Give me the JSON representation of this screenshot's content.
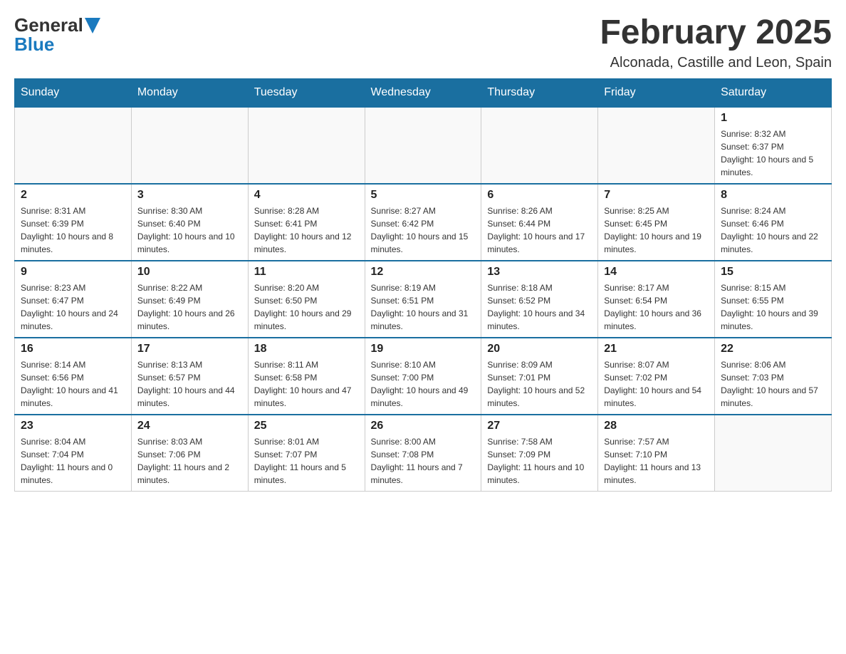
{
  "logo": {
    "text_general": "General",
    "text_blue": "Blue"
  },
  "title": {
    "month_year": "February 2025",
    "location": "Alconada, Castille and Leon, Spain"
  },
  "weekdays": [
    "Sunday",
    "Monday",
    "Tuesday",
    "Wednesday",
    "Thursday",
    "Friday",
    "Saturday"
  ],
  "weeks": [
    [
      {
        "day": "",
        "info": ""
      },
      {
        "day": "",
        "info": ""
      },
      {
        "day": "",
        "info": ""
      },
      {
        "day": "",
        "info": ""
      },
      {
        "day": "",
        "info": ""
      },
      {
        "day": "",
        "info": ""
      },
      {
        "day": "1",
        "info": "Sunrise: 8:32 AM\nSunset: 6:37 PM\nDaylight: 10 hours and 5 minutes."
      }
    ],
    [
      {
        "day": "2",
        "info": "Sunrise: 8:31 AM\nSunset: 6:39 PM\nDaylight: 10 hours and 8 minutes."
      },
      {
        "day": "3",
        "info": "Sunrise: 8:30 AM\nSunset: 6:40 PM\nDaylight: 10 hours and 10 minutes."
      },
      {
        "day": "4",
        "info": "Sunrise: 8:28 AM\nSunset: 6:41 PM\nDaylight: 10 hours and 12 minutes."
      },
      {
        "day": "5",
        "info": "Sunrise: 8:27 AM\nSunset: 6:42 PM\nDaylight: 10 hours and 15 minutes."
      },
      {
        "day": "6",
        "info": "Sunrise: 8:26 AM\nSunset: 6:44 PM\nDaylight: 10 hours and 17 minutes."
      },
      {
        "day": "7",
        "info": "Sunrise: 8:25 AM\nSunset: 6:45 PM\nDaylight: 10 hours and 19 minutes."
      },
      {
        "day": "8",
        "info": "Sunrise: 8:24 AM\nSunset: 6:46 PM\nDaylight: 10 hours and 22 minutes."
      }
    ],
    [
      {
        "day": "9",
        "info": "Sunrise: 8:23 AM\nSunset: 6:47 PM\nDaylight: 10 hours and 24 minutes."
      },
      {
        "day": "10",
        "info": "Sunrise: 8:22 AM\nSunset: 6:49 PM\nDaylight: 10 hours and 26 minutes."
      },
      {
        "day": "11",
        "info": "Sunrise: 8:20 AM\nSunset: 6:50 PM\nDaylight: 10 hours and 29 minutes."
      },
      {
        "day": "12",
        "info": "Sunrise: 8:19 AM\nSunset: 6:51 PM\nDaylight: 10 hours and 31 minutes."
      },
      {
        "day": "13",
        "info": "Sunrise: 8:18 AM\nSunset: 6:52 PM\nDaylight: 10 hours and 34 minutes."
      },
      {
        "day": "14",
        "info": "Sunrise: 8:17 AM\nSunset: 6:54 PM\nDaylight: 10 hours and 36 minutes."
      },
      {
        "day": "15",
        "info": "Sunrise: 8:15 AM\nSunset: 6:55 PM\nDaylight: 10 hours and 39 minutes."
      }
    ],
    [
      {
        "day": "16",
        "info": "Sunrise: 8:14 AM\nSunset: 6:56 PM\nDaylight: 10 hours and 41 minutes."
      },
      {
        "day": "17",
        "info": "Sunrise: 8:13 AM\nSunset: 6:57 PM\nDaylight: 10 hours and 44 minutes."
      },
      {
        "day": "18",
        "info": "Sunrise: 8:11 AM\nSunset: 6:58 PM\nDaylight: 10 hours and 47 minutes."
      },
      {
        "day": "19",
        "info": "Sunrise: 8:10 AM\nSunset: 7:00 PM\nDaylight: 10 hours and 49 minutes."
      },
      {
        "day": "20",
        "info": "Sunrise: 8:09 AM\nSunset: 7:01 PM\nDaylight: 10 hours and 52 minutes."
      },
      {
        "day": "21",
        "info": "Sunrise: 8:07 AM\nSunset: 7:02 PM\nDaylight: 10 hours and 54 minutes."
      },
      {
        "day": "22",
        "info": "Sunrise: 8:06 AM\nSunset: 7:03 PM\nDaylight: 10 hours and 57 minutes."
      }
    ],
    [
      {
        "day": "23",
        "info": "Sunrise: 8:04 AM\nSunset: 7:04 PM\nDaylight: 11 hours and 0 minutes."
      },
      {
        "day": "24",
        "info": "Sunrise: 8:03 AM\nSunset: 7:06 PM\nDaylight: 11 hours and 2 minutes."
      },
      {
        "day": "25",
        "info": "Sunrise: 8:01 AM\nSunset: 7:07 PM\nDaylight: 11 hours and 5 minutes."
      },
      {
        "day": "26",
        "info": "Sunrise: 8:00 AM\nSunset: 7:08 PM\nDaylight: 11 hours and 7 minutes."
      },
      {
        "day": "27",
        "info": "Sunrise: 7:58 AM\nSunset: 7:09 PM\nDaylight: 11 hours and 10 minutes."
      },
      {
        "day": "28",
        "info": "Sunrise: 7:57 AM\nSunset: 7:10 PM\nDaylight: 11 hours and 13 minutes."
      },
      {
        "day": "",
        "info": ""
      }
    ]
  ]
}
